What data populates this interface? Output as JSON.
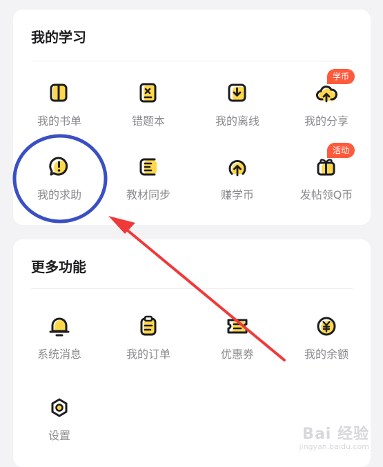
{
  "my_learning": {
    "title": "我的学习",
    "items": [
      {
        "label": "我的书单",
        "icon": "book-icon"
      },
      {
        "label": "错题本",
        "icon": "error-book-icon"
      },
      {
        "label": "我的离线",
        "icon": "offline-download-icon"
      },
      {
        "label": "我的分享",
        "icon": "cloud-upload-icon",
        "badge": "学币"
      },
      {
        "label": "我的求助",
        "icon": "help-chat-icon"
      },
      {
        "label": "教材同步",
        "icon": "textbook-sync-icon"
      },
      {
        "label": "赚学币",
        "icon": "earn-coin-icon"
      },
      {
        "label": "发帖领Q币",
        "icon": "gift-icon",
        "badge": "活动"
      }
    ]
  },
  "more_functions": {
    "title": "更多功能",
    "items": [
      {
        "label": "系统消息",
        "icon": "bell-icon"
      },
      {
        "label": "我的订单",
        "icon": "clipboard-icon"
      },
      {
        "label": "优惠券",
        "icon": "coupon-icon"
      },
      {
        "label": "我的余额",
        "icon": "yuan-balance-icon"
      },
      {
        "label": "设置",
        "icon": "settings-icon"
      }
    ]
  },
  "watermark": {
    "main": "Bai 经验",
    "sub": "jingyan.baidu.com"
  },
  "colors": {
    "accent_yellow": "#ffd84a",
    "badge": "#ff5a3c",
    "annotation_blue": "#3a4fc4",
    "annotation_red": "#f03a3a"
  }
}
